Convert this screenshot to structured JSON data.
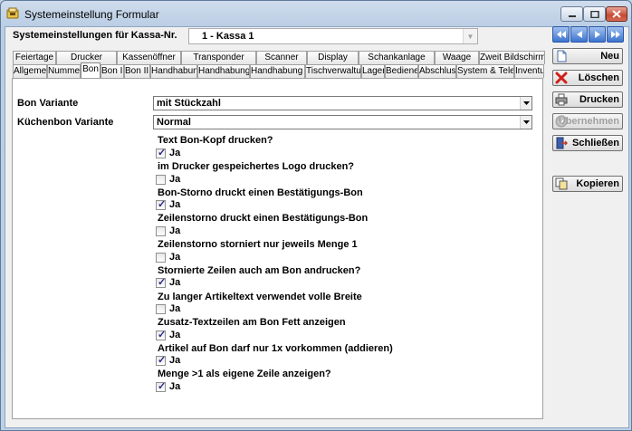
{
  "window": {
    "title": "Systemeinstellung Formular"
  },
  "header": {
    "kassa_label": "Systemeinstellungen für Kassa-Nr.",
    "kassa_value": "1 - Kassa 1"
  },
  "tabs_row1": [
    "Feiertage",
    "Drucker",
    "Kassenöffner",
    "Transponder",
    "Scanner",
    "Display",
    "Schankanlage",
    "Waage",
    "Zweit Bildschirm"
  ],
  "tabs_row2": [
    "Allgemein",
    "Nummern",
    "Bon",
    "Bon II",
    "Bon III",
    "Handhabung",
    "Handhabung II",
    "Handhabung III",
    "Tischverwaltung",
    "Lager",
    "Bediener",
    "Abschluss",
    "System & Telefon",
    "Inventur"
  ],
  "active_tab": "Bon",
  "form": {
    "bon_variante_label": "Bon Variante",
    "bon_variante_value": "mit Stückzahl",
    "kuechenbon_label": "Küchenbon Variante",
    "kuechenbon_value": "Normal",
    "options": [
      {
        "question": "Text Bon-Kopf drucken?",
        "label": "Ja",
        "checked": true
      },
      {
        "question": "im Drucker gespeichertes Logo drucken?",
        "label": "Ja",
        "checked": false
      },
      {
        "question": "Bon-Storno druckt einen Bestätigungs-Bon",
        "label": "Ja",
        "checked": true
      },
      {
        "question": "Zeilenstorno druckt einen Bestätigungs-Bon",
        "label": "Ja",
        "checked": false
      },
      {
        "question": "Zeilenstorno storniert nur jeweils Menge 1",
        "label": "Ja",
        "checked": false
      },
      {
        "question": "Stornierte Zeilen auch am Bon andrucken?",
        "label": "Ja",
        "checked": true
      },
      {
        "question": "Zu langer Artikeltext verwendet volle Breite",
        "label": "Ja",
        "checked": false
      },
      {
        "question": "Zusatz-Textzeilen am Bon Fett anzeigen",
        "label": "Ja",
        "checked": true
      },
      {
        "question": "Artikel auf Bon darf nur 1x vorkommen (addieren)",
        "label": "Ja",
        "checked": true
      },
      {
        "question": "Menge >1 als eigene Zeile anzeigen?",
        "label": "Ja",
        "checked": true
      }
    ]
  },
  "buttons": {
    "neu": "Neu",
    "loeschen": "Löschen",
    "drucken": "Drucken",
    "uebernehmen": "Übernehmen",
    "schliessen": "Schließen",
    "kopieren": "Kopieren"
  }
}
